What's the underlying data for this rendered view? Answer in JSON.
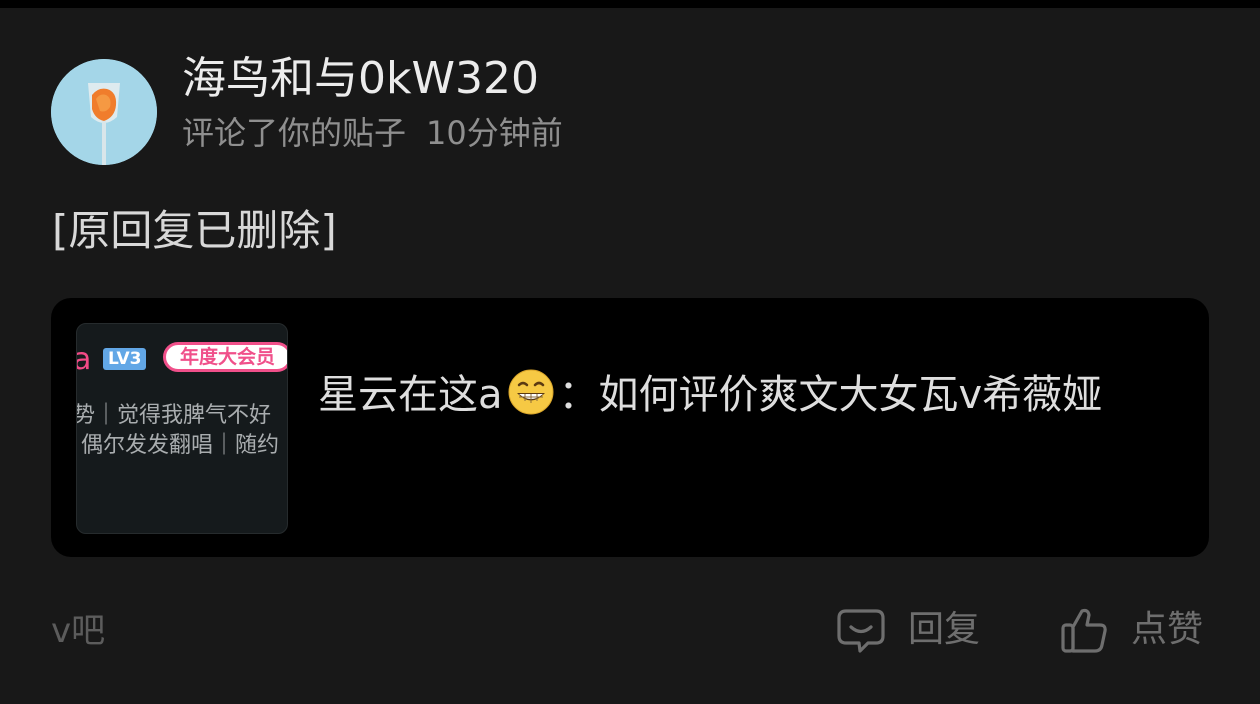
{
  "notification": {
    "user_name": "海鸟和与0kW320",
    "action_text": "评论了你的贴子",
    "time": "10分钟前",
    "reply_content": "[原回复已删除]"
  },
  "post": {
    "author": "星云在这a",
    "author_emoji": "grinning-face-emoji",
    "separator": "：",
    "title": "如何评价爽文大女瓦v希薇娅",
    "thumbnail": {
      "name_fragment": "a",
      "level_badge": "LV3",
      "vip_badge": "年度大会员",
      "line1": "势｜觉得我脾气不好",
      "line2": "偶尔发发翻唱｜随约"
    }
  },
  "footer": {
    "forum": "v吧",
    "reply_label": "回复",
    "like_label": "点赞"
  },
  "colors": {
    "background": "#181818",
    "card": "#000000",
    "avatar_bg": "#a4d6e8",
    "vip_pink": "#f0508a",
    "level_blue": "#62a7e6"
  }
}
